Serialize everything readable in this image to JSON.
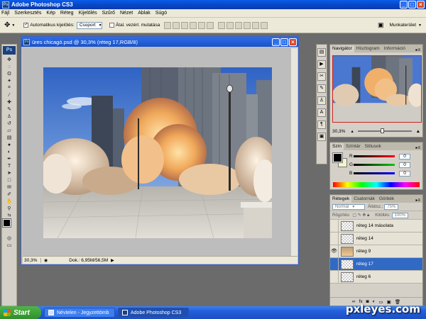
{
  "app": {
    "title": "Adobe Photoshop CS3",
    "logo": "Ps"
  },
  "menu": [
    "Fájl",
    "Szerkesztés",
    "Kép",
    "Réteg",
    "Kijelölés",
    "Szűrő",
    "Nézet",
    "Ablak",
    "Súgó"
  ],
  "options": {
    "auto_select_label": "Automatikus kijelölés:",
    "auto_select_value": "Csoport",
    "transform_label": "Átal. vezérl. mutatása",
    "workspace_label": "Munkaterület"
  },
  "document": {
    "title": "üres chicagó.psd @ 30,3% (réteg 17,RGB/8)",
    "zoom": "30,3%",
    "info": "Dok.: 6,95M/56,5M"
  },
  "navigator": {
    "tabs": [
      "Navigátor",
      "Hisztogram",
      "Információ"
    ],
    "zoom": "30,3%"
  },
  "color_panel": {
    "tabs": [
      "Szín",
      "Színtár",
      "Stílusok"
    ],
    "channels": [
      {
        "label": "R",
        "value": "0",
        "color": "#d02020"
      },
      {
        "label": "G",
        "value": "0",
        "color": "#20a020"
      },
      {
        "label": "B",
        "value": "0",
        "color": "#2040d0"
      }
    ]
  },
  "layers_panel": {
    "tabs": [
      "Rétegek",
      "Csatornák",
      "Görbék"
    ],
    "blend_mode": "Normál",
    "opacity_label": "Átlátsz.:",
    "opacity_value": "75%",
    "lock_label": "Rögzítés:",
    "fill_label": "Kitöltés:",
    "fill_value": "100%",
    "layers": [
      {
        "name": "réteg 14 másolata",
        "visible": false,
        "selected": false
      },
      {
        "name": "réteg 14",
        "visible": false,
        "selected": false
      },
      {
        "name": "réteg 9",
        "visible": true,
        "selected": false
      },
      {
        "name": "réteg 17",
        "visible": false,
        "selected": true
      },
      {
        "name": "réteg 6",
        "visible": false,
        "selected": false
      }
    ],
    "footer_icons": [
      "link-icon",
      "fx-icon",
      "mask-icon",
      "adjustment-icon",
      "group-icon",
      "new-layer-icon",
      "trash-icon"
    ]
  },
  "taskbar": {
    "start": "Start",
    "tasks": [
      "Névtelen - Jegyzettömb",
      "Adobe Photoshop CS3"
    ]
  },
  "watermark": "pxleyes.com"
}
